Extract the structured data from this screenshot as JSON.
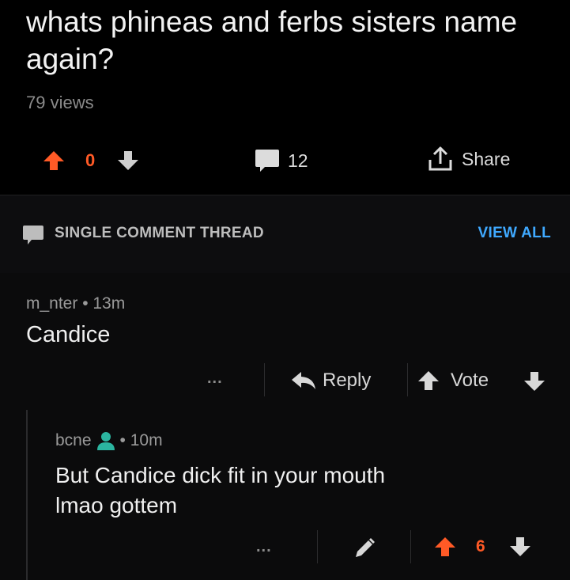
{
  "post": {
    "title": "whats phineas and ferbs sisters name again?",
    "views": "79 views",
    "score": "0",
    "comment_count": "12",
    "share_label": "Share"
  },
  "thread_bar": {
    "label": "SINGLE COMMENT THREAD",
    "view_all": "VIEW ALL"
  },
  "comment": {
    "meta": "m_nter • 13m",
    "body": "Candice",
    "more": "...",
    "reply_label": "Reply",
    "vote_label": "Vote"
  },
  "reply": {
    "author": "bcne",
    "time": "• 10m",
    "line1": "But Candice dick fit in your mouth",
    "line2": "lmao gottem",
    "more": "...",
    "score": "6"
  },
  "colors": {
    "upvote": "#ff5a26",
    "link": "#3fa9ff",
    "user_icon": "#2bb5a0",
    "muted": "#8b8b8b"
  },
  "icons": {
    "upvote": "arrow-up-icon",
    "downvote": "arrow-down-icon",
    "comment": "speech-bubble-icon",
    "share": "share-icon",
    "reply": "reply-arrow-icon",
    "edit": "pencil-icon",
    "user": "user-icon"
  }
}
